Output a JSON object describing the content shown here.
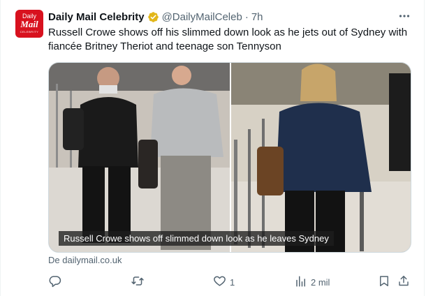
{
  "tweet": {
    "author": {
      "name": "Daily Mail Celebrity",
      "handle": "@DailyMailCeleb",
      "avatar": {
        "line1": "Daily",
        "line2": "Mail",
        "line3": "CELEBRITY"
      },
      "verified_icon": "verified-badge-icon",
      "badge_color": "#e2b719"
    },
    "separator": "·",
    "time": "7h",
    "more_icon": "more-options-icon",
    "text": "Russell Crowe shows off his slimmed down look as he jets out of Sydney with fiancée Britney Theriot and teenage son Tennyson",
    "media": {
      "caption": "Russell Crowe shows off slimmed down look as he leaves Sydney"
    },
    "source": "De dailymail.co.uk",
    "actions": {
      "reply": {
        "icon": "reply-icon",
        "count": ""
      },
      "retweet": {
        "icon": "retweet-icon",
        "count": ""
      },
      "like": {
        "icon": "heart-icon",
        "count": "1"
      },
      "views": {
        "icon": "views-icon",
        "count": "2 mil"
      },
      "bookmark": {
        "icon": "bookmark-icon"
      },
      "share": {
        "icon": "share-icon"
      }
    }
  },
  "colors": {
    "text": "#0f1419",
    "secondary": "#536471",
    "brand_red": "#d8111e"
  }
}
